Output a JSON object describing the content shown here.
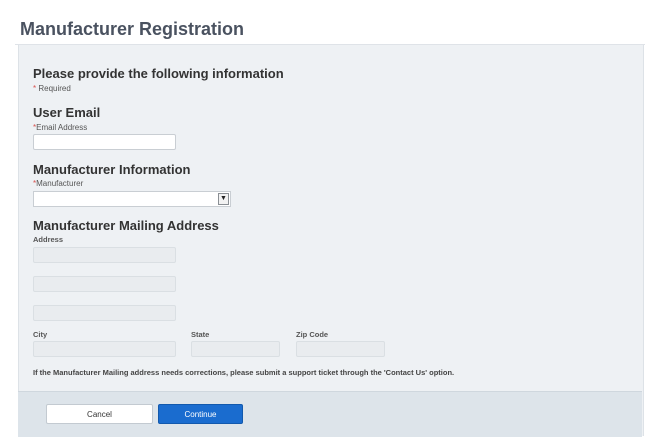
{
  "page": {
    "title": "Manufacturer Registration"
  },
  "form": {
    "intro": "Please provide the following information",
    "required_star": "*",
    "required_note": "Required",
    "user_email": {
      "heading": "User Email",
      "label": "Email Address",
      "value": ""
    },
    "manufacturer_info": {
      "heading": "Manufacturer Information",
      "label": "Manufacturer",
      "selected": ""
    },
    "mailing_address": {
      "heading": "Manufacturer Mailing Address",
      "address_label": "Address",
      "address_lines": [
        "",
        "",
        ""
      ],
      "city_label": "City",
      "state_label": "State",
      "zip_label": "Zip Code"
    },
    "correction_note": "If the Manufacturer Mailing address needs corrections, please submit a support ticket through the 'Contact Us' option."
  },
  "footer": {
    "cancel_label": "Cancel",
    "continue_label": "Continue"
  },
  "colors": {
    "panel_bg": "#eef1f4",
    "footer_bg": "#dde4ea",
    "primary_button": "#1a6ccf",
    "required_star": "#d9534f"
  },
  "icons": {
    "select_arrow": "chevron-down-icon"
  }
}
